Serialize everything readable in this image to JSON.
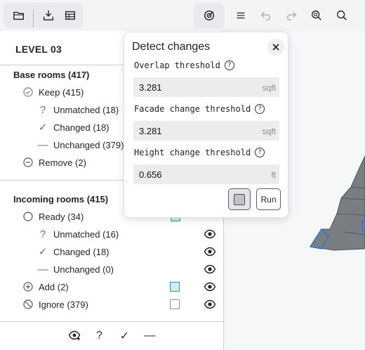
{
  "toolbar": {
    "left_icons": [
      "folder-open-icon",
      "import-icon",
      "table-icon"
    ],
    "right_icons": [
      "detect-changes-icon",
      "menu-icon",
      "undo-icon",
      "redo-icon",
      "zoom-fit-icon",
      "search-icon"
    ]
  },
  "panel": {
    "title": "LEVEL 03",
    "base": {
      "heading": "Base rooms (417)",
      "keep": "Keep (415)",
      "unmatched": "Unmatched (18)",
      "changed": "Changed (18)",
      "unchanged": "Unchanged (379)",
      "remove": "Remove (2)"
    },
    "incoming": {
      "heading": "Incoming rooms (415)",
      "ready": "Ready (34)",
      "unmatched": "Unmatched (16)",
      "changed": "Changed (18)",
      "unchanged": "Unchanged (0)",
      "add": "Add (2)",
      "ignore": "Ignore (379)"
    },
    "glyphs": {
      "question": "?",
      "check": "✓",
      "dash": "—"
    },
    "footer": {
      "help": "?",
      "check": "✓",
      "dash": "—"
    }
  },
  "popover": {
    "title": "Detect changes",
    "overlap": {
      "label": "Overlap threshold",
      "value": "3.281",
      "unit": "sqft"
    },
    "facade": {
      "label": "Facade change threshold",
      "value": "3.281",
      "unit": "sqft"
    },
    "height": {
      "label": "Height change threshold",
      "value": "0.656",
      "unit": "ft"
    },
    "help_glyph": "?",
    "run_label": "Run"
  },
  "colors": {
    "accent_cyan": "#c7eff5",
    "shape_fill": "#7a7d82",
    "shape_edge_blue": "#2f6fd6"
  }
}
